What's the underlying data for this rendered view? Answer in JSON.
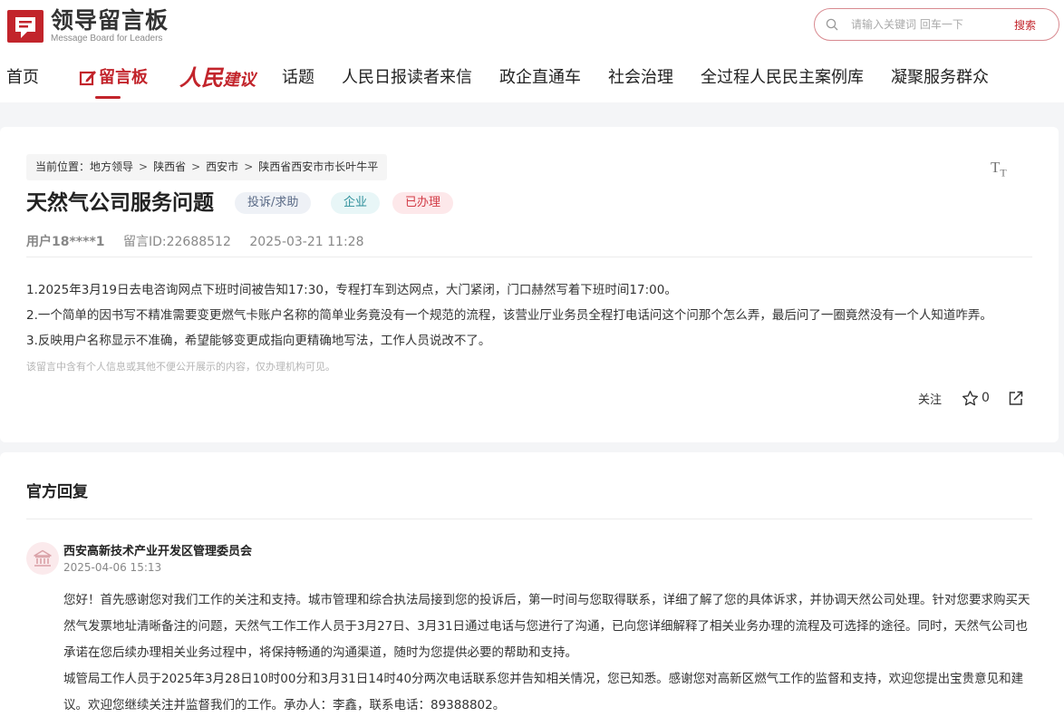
{
  "header": {
    "logo_title": "领导留言板",
    "logo_subtitle": "Message Board for Leaders",
    "search_placeholder": "请输入关键词 回车一下",
    "search_button": "搜索"
  },
  "nav": {
    "home": "首页",
    "message_board": "留言板",
    "people_suggest_a": "人民",
    "people_suggest_b": "建议",
    "topics": "话题",
    "readers_letters": "人民日报读者来信",
    "gov_business": "政企直通车",
    "social_governance": "社会治理",
    "democracy_cases": "全过程人民民主案例库",
    "service_groups": "凝聚服务群众"
  },
  "breadcrumb": {
    "prefix": "当前位置：",
    "items": [
      "地方领导",
      "陕西省",
      "西安市",
      "陕西省西安市市长叶牛平"
    ],
    "separator": ">"
  },
  "font_toggle": {
    "big": "T",
    "small": "T"
  },
  "message": {
    "title": "天然气公司服务问题",
    "tags": {
      "type": "投诉/求助",
      "org": "企业",
      "status": "已办理"
    },
    "user": "用户18****1",
    "message_id": "留言ID:22688512",
    "datetime": "2025-03-21 11:28",
    "lines": [
      "1.2025年3月19日去电咨询网点下班时间被告知17:30，专程打车到达网点，大门紧闭，门口赫然写着下班时间17:00。",
      "2.一个简单的因书写不精准需要变更燃气卡账户名称的简单业务竟没有一个规范的流程，该营业厅业务员全程打电话问这个问那个怎么弄，最后问了一圈竟然没有一个人知道咋弄。",
      "3.反映用户名称显示不准确，希望能够变更成指向更精确地写法，工作人员说改不了。"
    ],
    "privacy_note": "该留言中含有个人信息或其他不便公开展示的内容，仅办理机构可见。"
  },
  "actions": {
    "follow": "关注",
    "star_count": "0"
  },
  "reply": {
    "heading": "官方回复",
    "org_name": "西安高新技术产业开发区管理委员会",
    "date": "2025-04-06 15:13",
    "paragraph1": "您好！首先感谢您对我们工作的关注和支持。城市管理和综合执法局接到您的投诉后，第一时间与您取得联系，详细了解了您的具体诉求，并协调天然公司处理。针对您要求购买天然气发票地址清晰备注的问题，天然气工作工作人员于3月27日、3月31日通过电话与您进行了沟通，已向您详细解释了相关业务办理的流程及可选择的途径。同时，天然气公司也承诺在您后续办理相关业务过程中，将保持畅通的沟通渠道，随时为您提供必要的帮助和支持。",
    "paragraph2": "城管局工作人员于2025年3月28日10时00分和3月31日14时40分两次电话联系您并告知相关情况，您已知悉。感谢您对高新区燃气工作的监督和支持，欢迎您提出宝贵意见和建议。欢迎您继续关注并监督我们的工作。承办人：李鑫，联系电话：89388802。"
  },
  "colors": {
    "brand_red": "#c2242b",
    "page_bg": "#f4f5f7"
  }
}
